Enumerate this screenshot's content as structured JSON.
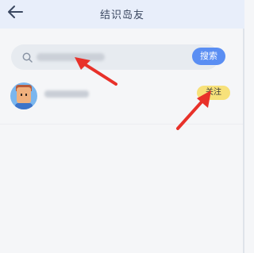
{
  "header": {
    "back_icon": "arrow-left-icon",
    "title": "结识岛友"
  },
  "search": {
    "icon": "search-icon",
    "value": "",
    "button_label": "搜索",
    "button_color": "#5a8ef3"
  },
  "results": [
    {
      "avatar": "avatar",
      "username": "",
      "follow_label": "关注",
      "follow_color": "#f7e17a"
    }
  ],
  "annotations": {
    "arrow_color": "#e8312a"
  }
}
